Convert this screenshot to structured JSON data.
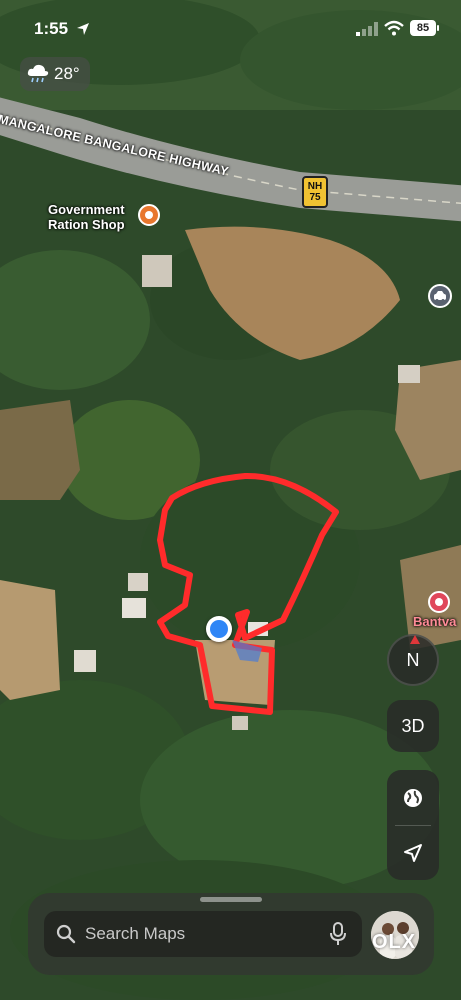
{
  "status_bar": {
    "time": "1:55",
    "battery": "85"
  },
  "weather": {
    "temperature": "28°",
    "icon": "rain-cloud-icon"
  },
  "map": {
    "road_label": "MANGALORE BANGALORE HIGHWAY",
    "route_shield": {
      "line1": "NH",
      "line2": "75"
    },
    "pois": [
      {
        "label_line1": "Government",
        "label_line2": "Ration Shop",
        "icon": "poi-pin-icon",
        "color": "#e8772e"
      },
      {
        "label": "Bantva",
        "icon": "poi-pin-icon",
        "color": "#e0475b"
      }
    ],
    "boundary_color": "#ff2b2b",
    "user_location_color": "#2f86f6"
  },
  "controls": {
    "compass_label": "N",
    "three_d_label": "3D",
    "globe_icon": "globe-icon",
    "locate_icon": "location-arrow-icon"
  },
  "search": {
    "placeholder": "Search Maps"
  },
  "watermark": "OLX"
}
